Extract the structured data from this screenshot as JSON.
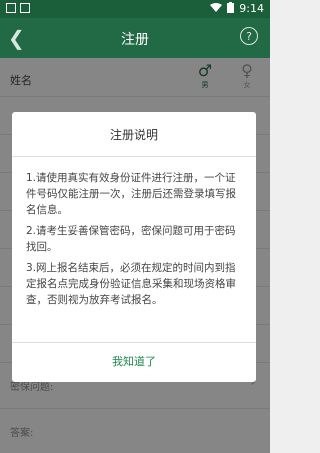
{
  "status_bar": {
    "time": "9:14"
  },
  "app_bar": {
    "title": "注册",
    "help_glyph": "?"
  },
  "form": {
    "name_label": "姓名",
    "gender_male": "男",
    "gender_female": "女",
    "security_question_label": "密保问题:",
    "answer_label": "答案:"
  },
  "dialog": {
    "title": "注册说明",
    "items": [
      "1.请使用真实有效身份证件进行注册，一个证件号码仅能注册一次，注册后还需登录填写报名信息。",
      "2.请考生妥善保管密码，密保问题可用于密码找回。",
      "3.网上报名结束后，必须在规定的时间内到指定报名点完成身份验证信息采集和现场资格审查，否则视为放弃考试报名。"
    ],
    "confirm_button": "我知道了"
  },
  "colors": {
    "app_bar": "#216a45",
    "accent": "#1f8a4f"
  }
}
